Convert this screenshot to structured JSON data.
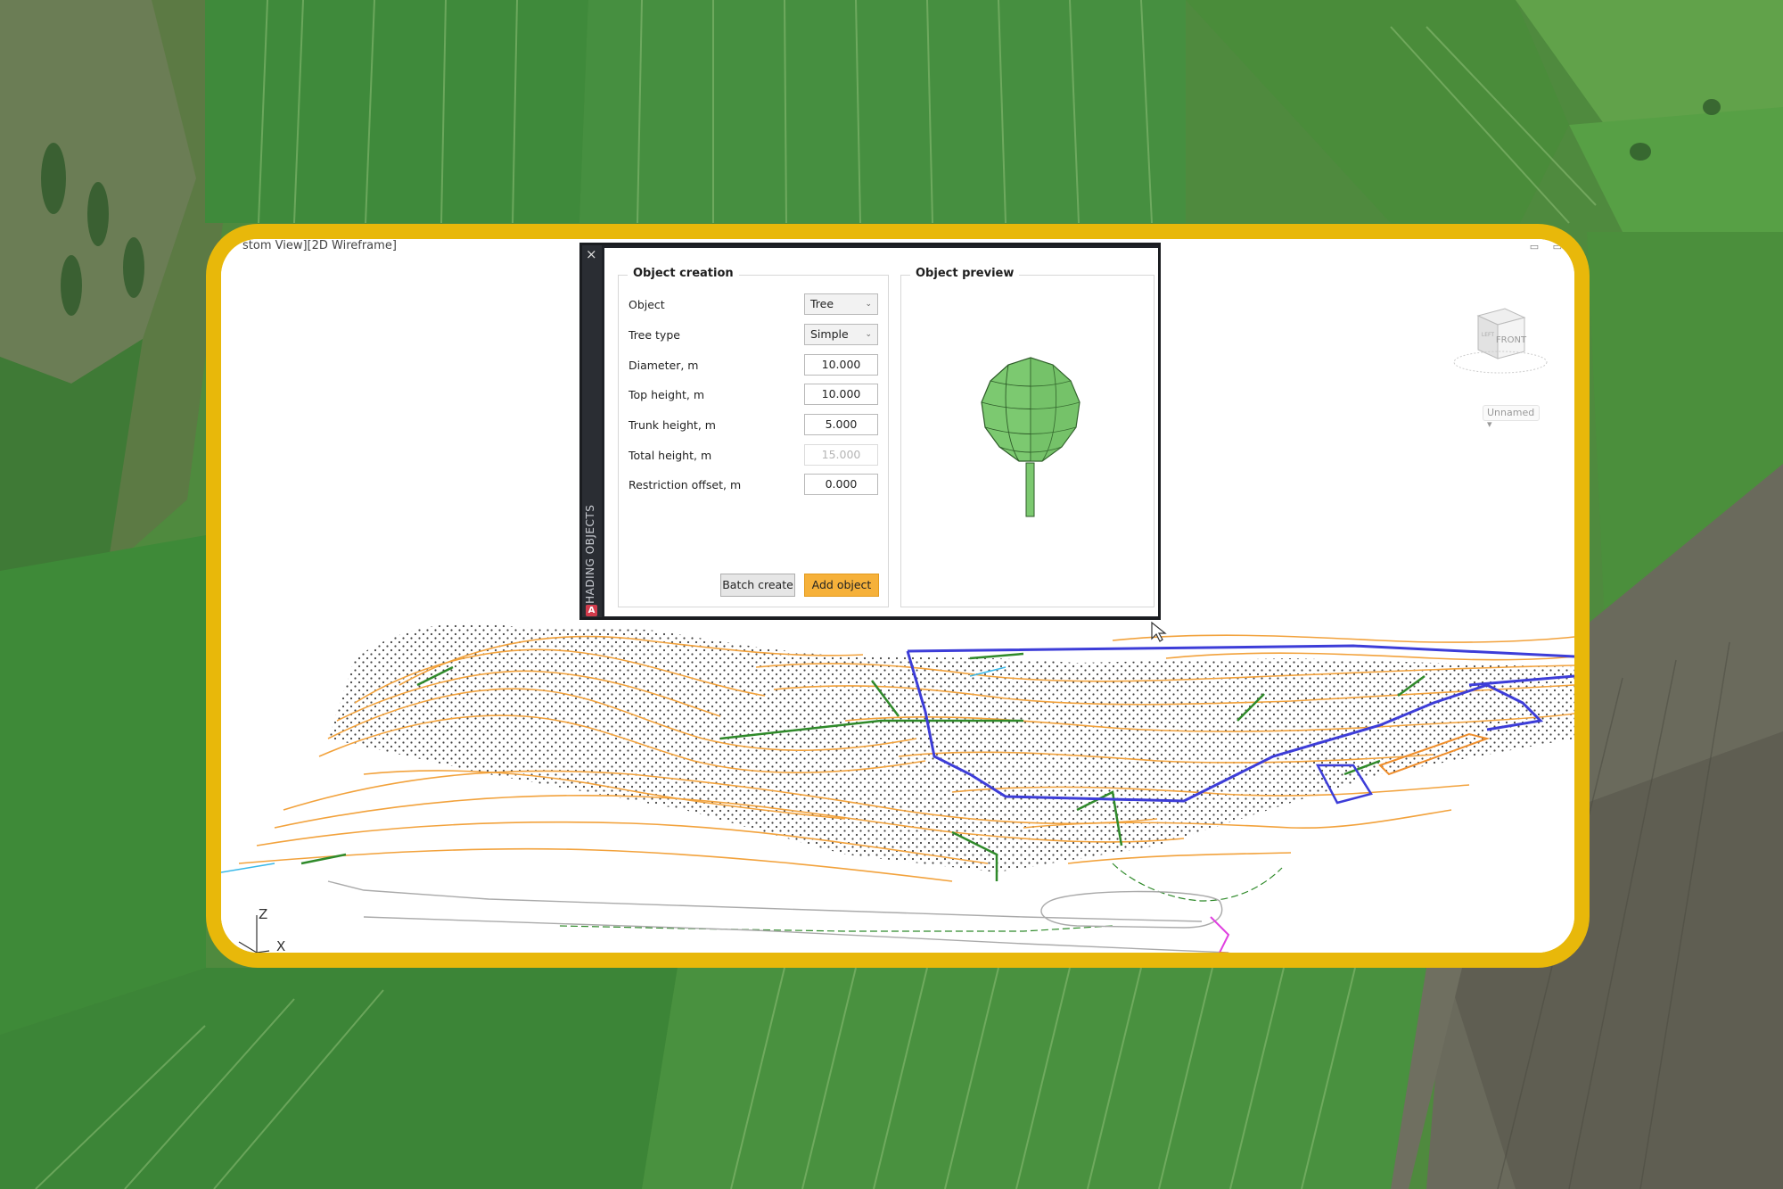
{
  "viewport": {
    "label": "stom View][2D Wireframe]",
    "viewcube_face_front": "FRONT",
    "viewcube_face_left": "LEFT",
    "view_dropdown": "Unnamed",
    "axis_z": "Z",
    "axis_x": "X"
  },
  "palette": {
    "vertical_title": "SHADING OBJECTS",
    "close_glyph": "×",
    "logo_glyph": "A",
    "creation": {
      "title": "Object creation",
      "object": {
        "label": "Object",
        "value": "Tree"
      },
      "tree_type": {
        "label": "Tree type",
        "value": "Simple"
      },
      "diameter": {
        "label": "Diameter, m",
        "value": "10.000"
      },
      "top_height": {
        "label": "Top height, m",
        "value": "10.000"
      },
      "trunk_height": {
        "label": "Trunk height, m",
        "value": "5.000"
      },
      "total_height": {
        "label": "Total height, m",
        "value": "15.000"
      },
      "restriction_offset": {
        "label": "Restriction offset, m",
        "value": "0.000"
      },
      "batch_create_label": "Batch create",
      "add_object_label": "Add object"
    },
    "preview": {
      "title": "Object preview"
    }
  },
  "colors": {
    "frame": "#e8b80a",
    "contour_orange": "#f2a23c",
    "feature_green": "#2f8a2a",
    "boundary_blue": "#3d3dd8",
    "tree_green": "#7cc970",
    "add_button": "#f6b13a"
  }
}
